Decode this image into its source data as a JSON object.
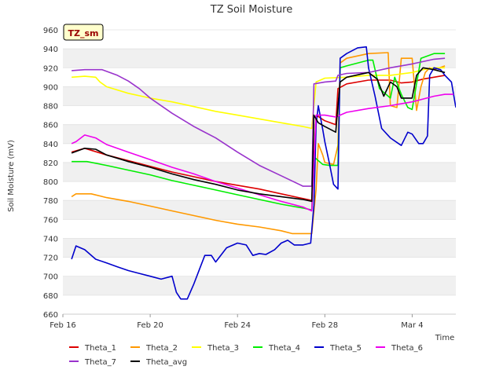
{
  "chart_data": {
    "type": "line",
    "title": "TZ Soil Moisture",
    "site_badge": "TZ_sm",
    "xlabel": "Time",
    "ylabel": "Soil Moisture (mV)",
    "ylim": [
      660,
      960
    ],
    "yticks": [
      660,
      680,
      700,
      720,
      740,
      760,
      780,
      800,
      820,
      840,
      860,
      880,
      900,
      920,
      940,
      960
    ],
    "xlim": [
      0,
      18
    ],
    "xticks": [
      {
        "x": 0,
        "label": "Feb 16"
      },
      {
        "x": 4,
        "label": "Feb 20"
      },
      {
        "x": 8,
        "label": "Feb 24"
      },
      {
        "x": 12,
        "label": "Feb 28"
      },
      {
        "x": 16,
        "label": "Mar 4"
      }
    ],
    "grid": "horizontal bands",
    "legend_position": "bottom",
    "series": [
      {
        "name": "Theta_1",
        "color": "#dd0000",
        "points": [
          [
            0.4,
            831
          ],
          [
            1,
            835
          ],
          [
            2,
            828
          ],
          [
            3,
            822
          ],
          [
            4,
            816
          ],
          [
            5,
            810
          ],
          [
            6,
            805
          ],
          [
            7,
            800
          ],
          [
            8,
            796
          ],
          [
            9,
            792
          ],
          [
            10,
            787
          ],
          [
            11,
            782
          ],
          [
            11.4,
            780
          ],
          [
            11.6,
            870
          ],
          [
            12,
            864
          ],
          [
            12.5,
            860
          ],
          [
            12.6,
            898
          ],
          [
            13,
            903
          ],
          [
            14,
            907
          ],
          [
            15,
            907
          ],
          [
            15.5,
            904
          ],
          [
            16,
            905
          ],
          [
            16.5,
            908
          ],
          [
            17,
            910
          ],
          [
            17.5,
            912
          ]
        ]
      },
      {
        "name": "Theta_2",
        "color": "#ff9900",
        "points": [
          [
            0.4,
            784
          ],
          [
            0.6,
            787
          ],
          [
            1.3,
            787
          ],
          [
            2,
            783
          ],
          [
            3,
            779
          ],
          [
            4,
            774
          ],
          [
            5,
            769
          ],
          [
            6,
            764
          ],
          [
            7,
            759
          ],
          [
            8,
            755
          ],
          [
            9,
            752
          ],
          [
            10,
            748
          ],
          [
            10.5,
            745
          ],
          [
            11.4,
            745
          ],
          [
            11.6,
            792
          ],
          [
            11.7,
            840
          ],
          [
            11.9,
            828
          ],
          [
            12,
            820
          ],
          [
            12.4,
            818
          ],
          [
            12.6,
            838
          ],
          [
            12.7,
            925
          ],
          [
            13,
            930
          ],
          [
            14,
            935
          ],
          [
            14.9,
            936
          ],
          [
            15,
            880
          ],
          [
            15.3,
            878
          ],
          [
            15.5,
            930
          ],
          [
            16,
            930
          ],
          [
            16.2,
            875
          ],
          [
            16.4,
            900
          ],
          [
            16.6,
            915
          ],
          [
            16.8,
            920
          ],
          [
            17,
            918
          ],
          [
            17.5,
            922
          ]
        ]
      },
      {
        "name": "Theta_3",
        "color": "#ffff00",
        "points": [
          [
            0.4,
            910
          ],
          [
            1,
            911
          ],
          [
            1.5,
            910
          ],
          [
            1.7,
            905
          ],
          [
            2,
            900
          ],
          [
            3,
            893
          ],
          [
            4,
            888
          ],
          [
            5,
            884
          ],
          [
            6,
            879
          ],
          [
            7,
            874
          ],
          [
            8,
            870
          ],
          [
            9,
            866
          ],
          [
            10,
            862
          ],
          [
            11,
            858
          ],
          [
            11.4,
            856
          ],
          [
            11.6,
            905
          ],
          [
            12,
            909
          ],
          [
            13,
            910
          ],
          [
            14,
            912
          ],
          [
            15,
            912
          ],
          [
            16,
            915
          ],
          [
            16.5,
            918
          ],
          [
            17,
            920
          ],
          [
            17.5,
            920
          ]
        ]
      },
      {
        "name": "Theta_4",
        "color": "#00ee00",
        "points": [
          [
            0.4,
            821
          ],
          [
            1.1,
            821
          ],
          [
            2,
            817
          ],
          [
            3,
            812
          ],
          [
            4,
            807
          ],
          [
            5,
            801
          ],
          [
            6,
            796
          ],
          [
            7,
            791
          ],
          [
            8,
            786
          ],
          [
            9,
            781
          ],
          [
            10,
            776
          ],
          [
            11,
            772
          ],
          [
            11.4,
            770
          ],
          [
            11.5,
            826
          ],
          [
            11.7,
            822
          ],
          [
            11.9,
            818
          ],
          [
            12.2,
            817
          ],
          [
            12.6,
            817
          ],
          [
            12.7,
            920
          ],
          [
            13,
            922
          ],
          [
            14,
            928
          ],
          [
            14.2,
            928
          ],
          [
            14.5,
            898
          ],
          [
            15,
            888
          ],
          [
            15.2,
            910
          ],
          [
            15.5,
            892
          ],
          [
            15.8,
            878
          ],
          [
            16,
            876
          ],
          [
            16.4,
            930
          ],
          [
            17,
            935
          ],
          [
            17.5,
            935
          ]
        ]
      },
      {
        "name": "Theta_5",
        "color": "#0000cc",
        "points": [
          [
            0.4,
            718
          ],
          [
            0.6,
            732
          ],
          [
            1,
            728
          ],
          [
            1.5,
            718
          ],
          [
            2,
            714
          ],
          [
            2.5,
            710
          ],
          [
            3,
            706
          ],
          [
            3.5,
            703
          ],
          [
            4,
            700
          ],
          [
            4.5,
            697
          ],
          [
            5,
            700
          ],
          [
            5.2,
            683
          ],
          [
            5.4,
            676
          ],
          [
            5.7,
            676
          ],
          [
            6,
            692
          ],
          [
            6.3,
            710
          ],
          [
            6.5,
            722
          ],
          [
            6.8,
            722
          ],
          [
            7,
            715
          ],
          [
            7.5,
            730
          ],
          [
            8,
            735
          ],
          [
            8.4,
            733
          ],
          [
            8.7,
            722
          ],
          [
            9,
            724
          ],
          [
            9.3,
            723
          ],
          [
            9.7,
            728
          ],
          [
            10,
            735
          ],
          [
            10.3,
            738
          ],
          [
            10.6,
            733
          ],
          [
            11,
            733
          ],
          [
            11.35,
            735
          ],
          [
            11.5,
            775
          ],
          [
            11.6,
            860
          ],
          [
            11.7,
            880
          ],
          [
            11.9,
            855
          ],
          [
            12,
            842
          ],
          [
            12.2,
            820
          ],
          [
            12.4,
            797
          ],
          [
            12.6,
            792
          ],
          [
            12.7,
            930
          ],
          [
            13,
            935
          ],
          [
            13.5,
            941
          ],
          [
            13.9,
            942
          ],
          [
            14,
            920
          ],
          [
            14.3,
            890
          ],
          [
            14.6,
            856
          ],
          [
            15,
            846
          ],
          [
            15.5,
            838
          ],
          [
            15.8,
            852
          ],
          [
            16,
            850
          ],
          [
            16.3,
            840
          ],
          [
            16.5,
            840
          ],
          [
            16.7,
            848
          ],
          [
            16.8,
            912
          ],
          [
            17,
            920
          ],
          [
            17.3,
            918
          ],
          [
            17.5,
            912
          ],
          [
            17.8,
            905
          ],
          [
            18,
            878
          ]
        ]
      },
      {
        "name": "Theta_6",
        "color": "#ee00ee",
        "points": [
          [
            0.4,
            840
          ],
          [
            0.6,
            842
          ],
          [
            1,
            849
          ],
          [
            1.5,
            846
          ],
          [
            2,
            839
          ],
          [
            3,
            831
          ],
          [
            4,
            823
          ],
          [
            5,
            815
          ],
          [
            6,
            808
          ],
          [
            7,
            800
          ],
          [
            8,
            793
          ],
          [
            9,
            786
          ],
          [
            10,
            779
          ],
          [
            11,
            773
          ],
          [
            11.4,
            769
          ],
          [
            11.6,
            870
          ],
          [
            12,
            870
          ],
          [
            12.5,
            868
          ],
          [
            13,
            873
          ],
          [
            14,
            877
          ],
          [
            15,
            880
          ],
          [
            16,
            884
          ],
          [
            17,
            890
          ],
          [
            17.5,
            892
          ],
          [
            17.9,
            892
          ]
        ]
      },
      {
        "name": "Theta_7",
        "color": "#9933cc",
        "points": [
          [
            0.4,
            917
          ],
          [
            1,
            918
          ],
          [
            1.8,
            918
          ],
          [
            2.5,
            912
          ],
          [
            3,
            906
          ],
          [
            3.5,
            898
          ],
          [
            4,
            888
          ],
          [
            5,
            872
          ],
          [
            6,
            858
          ],
          [
            7,
            846
          ],
          [
            8,
            831
          ],
          [
            9,
            817
          ],
          [
            10,
            806
          ],
          [
            11,
            795
          ],
          [
            11.4,
            795
          ],
          [
            11.5,
            903
          ],
          [
            12,
            905
          ],
          [
            12.5,
            906
          ],
          [
            12.6,
            912
          ],
          [
            13,
            914
          ],
          [
            14,
            915
          ],
          [
            15,
            920
          ],
          [
            16,
            924
          ],
          [
            17,
            929
          ],
          [
            17.5,
            930
          ]
        ]
      },
      {
        "name": "Theta_avg",
        "color": "#000000",
        "points": [
          [
            0.4,
            830
          ],
          [
            1,
            835
          ],
          [
            1.5,
            834
          ],
          [
            2,
            828
          ],
          [
            3,
            821
          ],
          [
            4,
            815
          ],
          [
            5,
            808
          ],
          [
            6,
            802
          ],
          [
            7,
            797
          ],
          [
            8,
            791
          ],
          [
            9,
            787
          ],
          [
            10,
            784
          ],
          [
            11,
            781
          ],
          [
            11.4,
            779
          ],
          [
            11.5,
            870
          ],
          [
            11.7,
            862
          ],
          [
            12,
            858
          ],
          [
            12.5,
            852
          ],
          [
            12.6,
            880
          ],
          [
            12.7,
            905
          ],
          [
            13,
            910
          ],
          [
            14,
            915
          ],
          [
            14.4,
            908
          ],
          [
            14.7,
            890
          ],
          [
            15,
            905
          ],
          [
            15.3,
            900
          ],
          [
            15.5,
            888
          ],
          [
            16,
            888
          ],
          [
            16.2,
            912
          ],
          [
            16.5,
            920
          ],
          [
            17,
            918
          ],
          [
            17.5,
            915
          ]
        ]
      }
    ]
  }
}
